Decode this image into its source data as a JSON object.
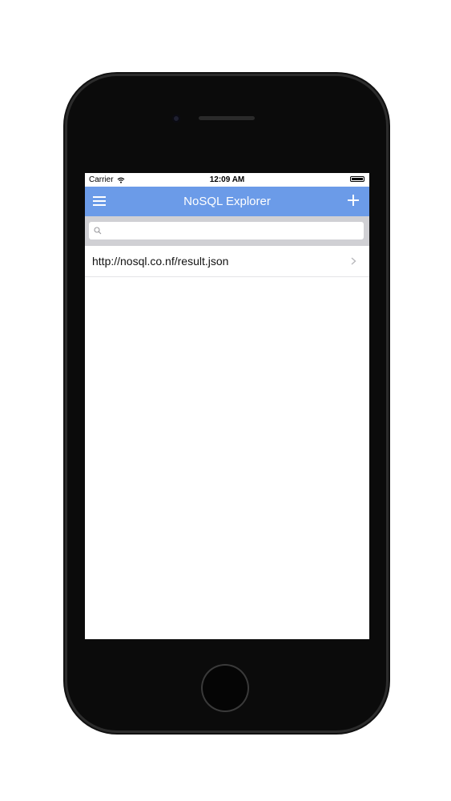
{
  "status_bar": {
    "carrier": "Carrier",
    "time": "12:09 AM"
  },
  "nav_bar": {
    "title": "NoSQL Explorer",
    "left_icon": "menu-icon",
    "right_icon": "add-icon",
    "color": "#6b9be8"
  },
  "search": {
    "placeholder": "",
    "value": ""
  },
  "list": {
    "items": [
      {
        "label": "http://nosql.co.nf/result.json",
        "icon": "chevron-right-icon"
      }
    ]
  }
}
